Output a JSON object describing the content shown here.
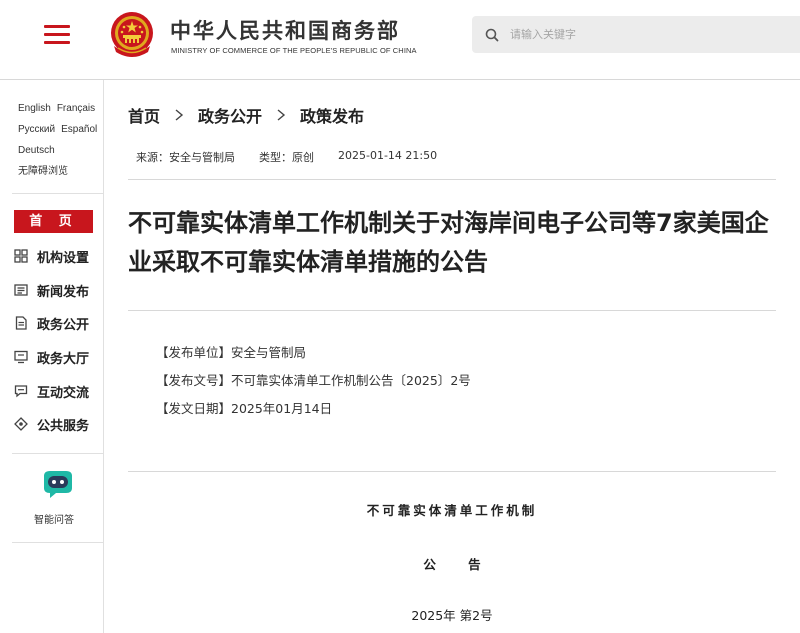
{
  "header": {
    "ministry_cn": "中华人民共和国商务部",
    "ministry_en": "MINISTRY OF COMMERCE OF THE PEOPLE'S REPUBLIC OF CHINA",
    "search_placeholder": "请输入关键字",
    "accent_color": "#c8161d"
  },
  "sidebar": {
    "languages": [
      "English",
      "Français",
      "Русский",
      "Español",
      "Deutsch",
      "无障碍浏览"
    ],
    "home_label": "首 页",
    "nav": [
      {
        "label": "机构设置",
        "icon": "grid-icon"
      },
      {
        "label": "新闻发布",
        "icon": "news-icon"
      },
      {
        "label": "政务公开",
        "icon": "document-icon"
      },
      {
        "label": "政务大厅",
        "icon": "monitor-icon"
      },
      {
        "label": "互动交流",
        "icon": "chat-icon"
      },
      {
        "label": "公共服务",
        "icon": "service-icon"
      }
    ],
    "ai_label": "智能问答"
  },
  "breadcrumb": [
    "首页",
    "政务公开",
    "政策发布"
  ],
  "meta": {
    "source": "来源：安全与管制局",
    "type": "类型：原创",
    "datetime": "2025-01-14 21:50"
  },
  "article": {
    "title": "不可靠实体清单工作机制关于对海岸间电子公司等7家美国企业采取不可靠实体清单措施的公告",
    "info": [
      "【发布单位】安全与管制局",
      "【发布文号】不可靠实体清单工作机制公告〔2025〕2号",
      "【发文日期】2025年01月14日"
    ],
    "issuer": "不可靠实体清单工作机制",
    "doc_kind": "公 告",
    "doc_number": "2025年 第2号"
  }
}
